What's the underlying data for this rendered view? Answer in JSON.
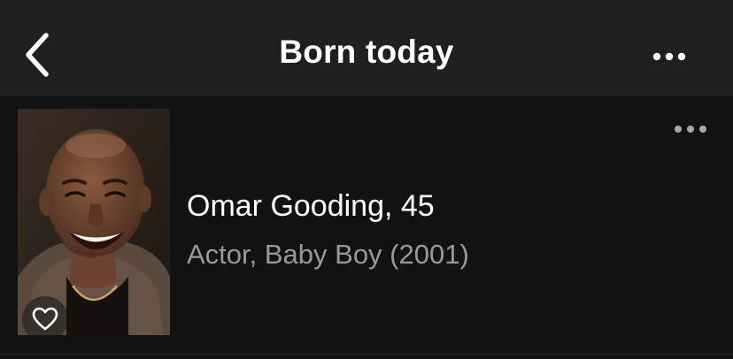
{
  "header": {
    "title": "Born today",
    "back_icon": "chevron-left-icon",
    "more_icon": "more-horizontal-icon"
  },
  "person": {
    "name_age": "Omar Gooding, 45",
    "subtitle": "Actor, Baby Boy (2001)",
    "photo_icon": "person-photo",
    "favorite_icon": "heart-outline-icon",
    "more_icon": "more-horizontal-icon"
  },
  "colors": {
    "background": "#121212",
    "header_background": "#1f1f1f",
    "primary_text": "#ffffff",
    "secondary_text": "#9a9a9a",
    "icon": "#ffffff"
  }
}
